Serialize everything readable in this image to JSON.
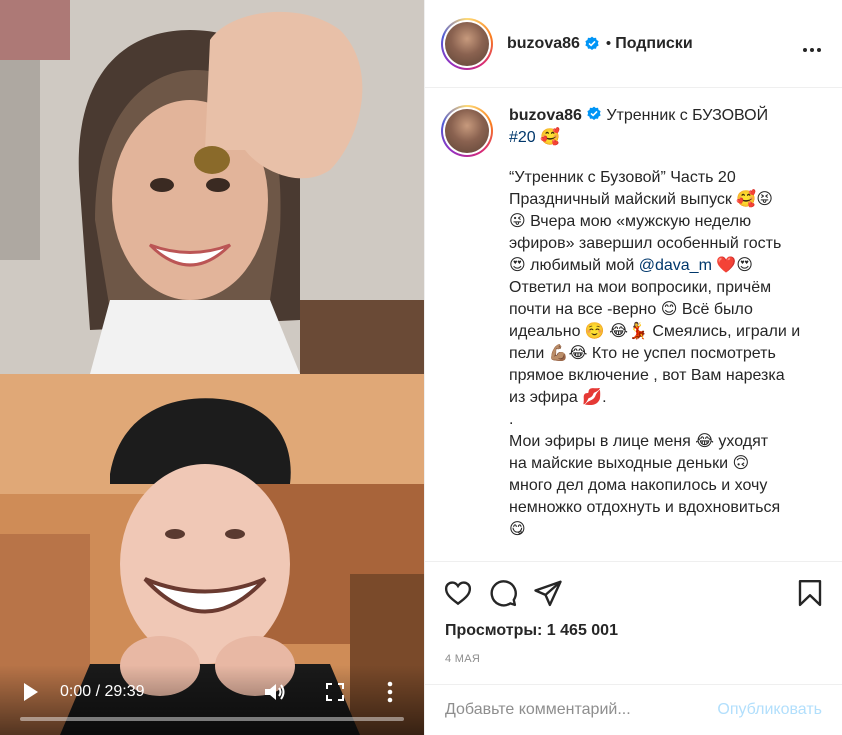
{
  "post": {
    "username": "buzova86",
    "follow_label": "Подписки",
    "dot": "•",
    "caption_title": "Утренник с БУЗОВОЙ",
    "hashtag": "#20",
    "emoji_title": "🥰",
    "caption_lines": [
      "“Утренник с Бузовой” Часть 20",
      "Праздничный майский выпуск 🥰😝",
      "😜 Вчера мою «мужскую неделю",
      "эфиров» завершил особенный гость",
      "😍 любимый мой ",
      "Ответил на мои вопросики, причём",
      "почти на все -верно 😊 Всё было",
      "идеально ☺️ 😂💃 Смеялись, играли и",
      "пели 💪🏽😂 Кто не успел посмотреть",
      "прямое включение , вот Вам нарезка",
      "из эфира 💋.",
      ".",
      "Мои эфиры в лице меня 😂 уходят",
      "на майские выходные деньки 🙃",
      "много дел дома накопилось и хочу",
      "немножко отдохнуть и вдохновиться",
      "😋"
    ],
    "mention": "@dava_m",
    "mention_suffix": " ❤️😍",
    "views_label": "Просмотры:",
    "views_value": "1 465 001",
    "date": "4 МАЯ",
    "comment_placeholder": "Добавьте комментарий...",
    "publish_label": "Опубликовать"
  },
  "video": {
    "time": "0:00 / 29:39",
    "progress": 0
  },
  "colors": {
    "link": "#00376b",
    "verified": "#0095f6",
    "publish_disabled": "#b2dffc"
  },
  "icons": {
    "like": "heart-icon",
    "comment": "comment-icon",
    "share": "paper-plane-icon",
    "save": "bookmark-icon",
    "more": "more-horizontal-icon",
    "play": "play-icon",
    "volume": "volume-icon",
    "fullscreen": "fullscreen-icon",
    "video_more": "more-vertical-icon",
    "verified": "verified-badge-icon"
  }
}
